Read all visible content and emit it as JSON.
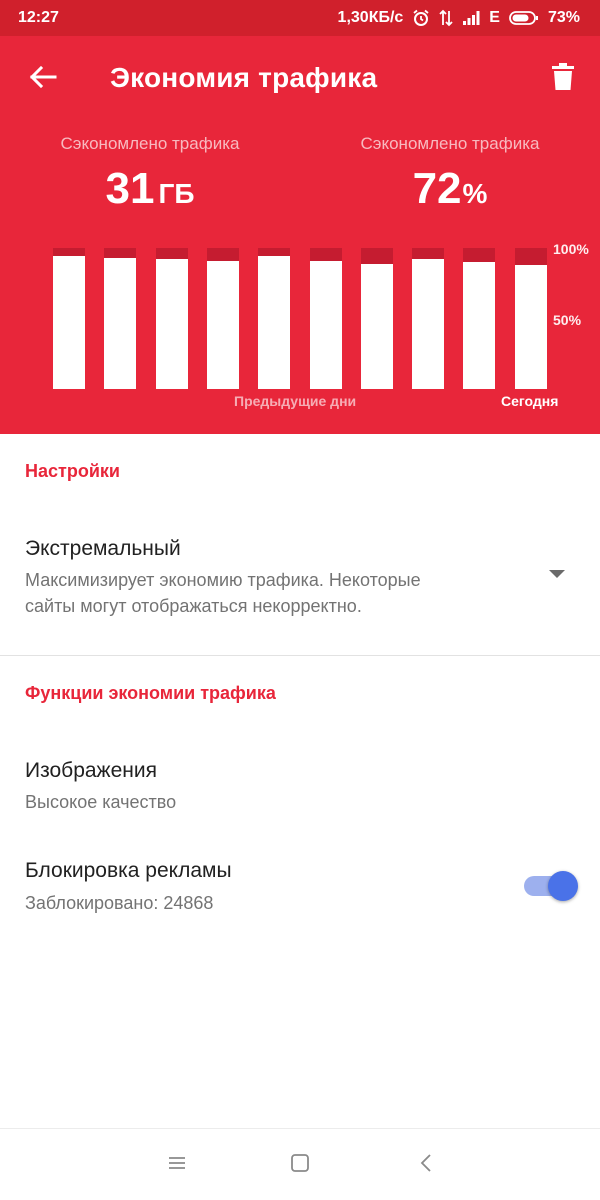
{
  "status_bar": {
    "time": "12:27",
    "speed": "1,30КБ/с",
    "network": "E",
    "battery": "73%",
    "icons": [
      "alarm-icon",
      "data-transfer-icon",
      "signal-icon",
      "battery-icon"
    ]
  },
  "header": {
    "title": "Экономия трафика",
    "back_icon": "arrow-left-icon",
    "delete_icon": "trash-icon",
    "saved_data": {
      "label": "Сэкономлено трафика",
      "value": "31",
      "unit": "ГБ"
    },
    "saved_percent": {
      "label": "Сэкономлено трафика",
      "value": "72",
      "unit": "%"
    }
  },
  "chart_data": {
    "type": "bar",
    "values": [
      94,
      93,
      92,
      91,
      94,
      91,
      89,
      92,
      90,
      88
    ],
    "ylim": [
      0,
      100
    ],
    "y_ticks": [
      "100%",
      "50%"
    ],
    "x_labels": {
      "previous": "Предыдущие дни",
      "today": "Сегодня"
    }
  },
  "settings": {
    "section_title": "Настройки",
    "mode": {
      "title": "Экстремальный",
      "description_line1": "Максимизирует экономию трафика. Некоторые",
      "description_line2": "сайты могут отображаться некорректно."
    }
  },
  "features": {
    "section_title": "Функции экономии трафика",
    "images": {
      "title": "Изображения",
      "value": "Высокое качество"
    },
    "ad_block": {
      "title": "Блокировка рекламы",
      "value": "Заблокировано: 24868",
      "enabled": true
    }
  },
  "nav_bar": {
    "icons": [
      "menu-icon",
      "home-icon",
      "back-icon"
    ]
  },
  "colors": {
    "header": "#e8263a",
    "status_bar": "#d0202c",
    "bar_remainder": "#c51c30",
    "accent_text": "#e8263a",
    "toggle_on": "#4a72e8"
  }
}
